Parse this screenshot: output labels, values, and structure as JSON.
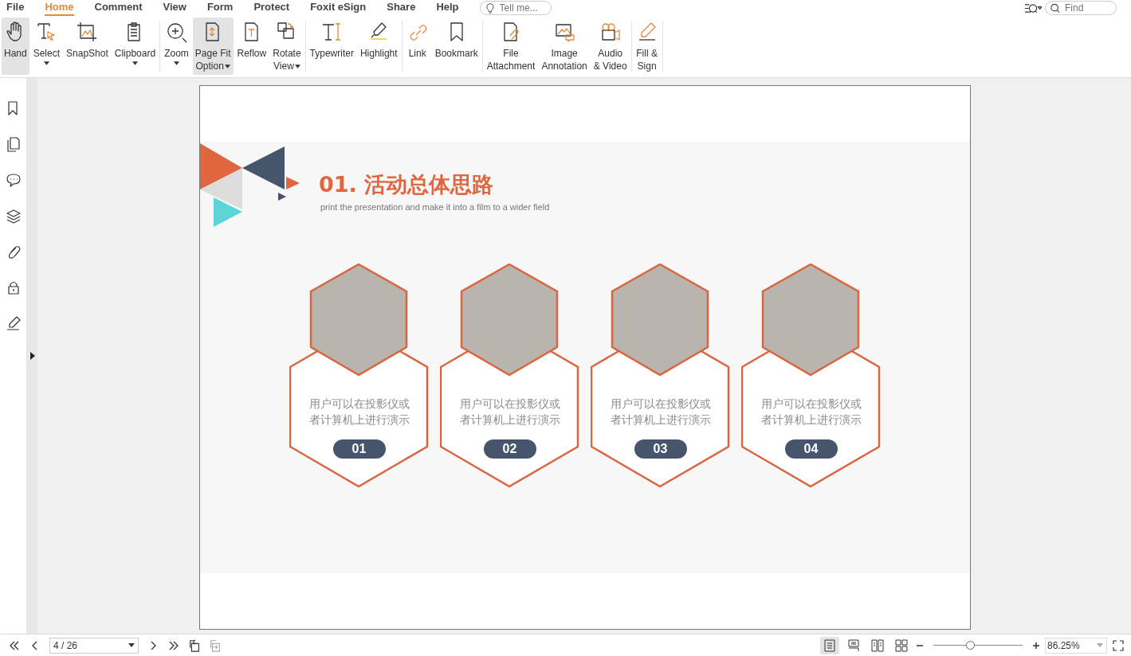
{
  "menu": [
    {
      "label": "File",
      "selected": false
    },
    {
      "label": "Home",
      "selected": true
    },
    {
      "label": "Comment",
      "selected": false
    },
    {
      "label": "View",
      "selected": false
    },
    {
      "label": "Form",
      "selected": false
    },
    {
      "label": "Protect",
      "selected": false
    },
    {
      "label": "Foxit eSign",
      "selected": false
    },
    {
      "label": "Share",
      "selected": false
    },
    {
      "label": "Help",
      "selected": false
    }
  ],
  "tell_me": {
    "placeholder": "Tell me..."
  },
  "find": {
    "placeholder": "Find"
  },
  "ribbon": [
    {
      "items": [
        {
          "lines": [
            "Hand"
          ],
          "selected": true
        },
        {
          "lines": [
            "Select"
          ],
          "caret_below": true,
          "selected": false
        },
        {
          "lines": [
            "SnapShot"
          ],
          "selected": false
        },
        {
          "lines": [
            "Clipboard"
          ],
          "caret_below": true,
          "selected": false
        }
      ]
    },
    {
      "items": [
        {
          "lines": [
            "Zoom"
          ],
          "caret_below": true,
          "selected": false
        },
        {
          "lines": [
            "Page Fit",
            "Option"
          ],
          "caret_inline": true,
          "selected": true
        },
        {
          "lines": [
            "Reflow"
          ],
          "selected": false
        },
        {
          "lines": [
            "Rotate",
            "View"
          ],
          "caret_inline": true,
          "selected": false
        }
      ]
    },
    {
      "items": [
        {
          "lines": [
            "Typewriter"
          ],
          "selected": false
        },
        {
          "lines": [
            "Highlight"
          ],
          "selected": false
        }
      ]
    },
    {
      "items": [
        {
          "lines": [
            "Link"
          ],
          "selected": false
        },
        {
          "lines": [
            "Bookmark"
          ],
          "selected": false
        }
      ]
    },
    {
      "items": [
        {
          "lines": [
            "File",
            "Attachment"
          ],
          "selected": false
        },
        {
          "lines": [
            "Image",
            "Annotation"
          ],
          "selected": false
        },
        {
          "lines": [
            "Audio",
            "& Video"
          ],
          "selected": false
        }
      ]
    },
    {
      "items": [
        {
          "lines": [
            "Fill &",
            "Sign"
          ],
          "selected": false
        }
      ]
    }
  ],
  "slide": {
    "title": "01. 活动总体思路",
    "subtitle": "print the presentation and make it into a film to a wider field",
    "cards": [
      {
        "text": "用户可以在投影仪或者计算机上进行演示",
        "number": "01"
      },
      {
        "text": "用户可以在投影仪或者计算机上进行演示",
        "number": "02"
      },
      {
        "text": "用户可以在投影仪或者计算机上进行演示",
        "number": "03"
      },
      {
        "text": "用户可以在投影仪或者计算机上进行演示",
        "number": "04"
      }
    ]
  },
  "status_bar": {
    "page": "4 / 26",
    "view_modes": [
      {
        "selected": true
      },
      {
        "selected": false
      },
      {
        "selected": false
      },
      {
        "selected": false
      }
    ],
    "zoom_slider": {
      "level": 0.42
    },
    "zoom": "86.25%"
  }
}
